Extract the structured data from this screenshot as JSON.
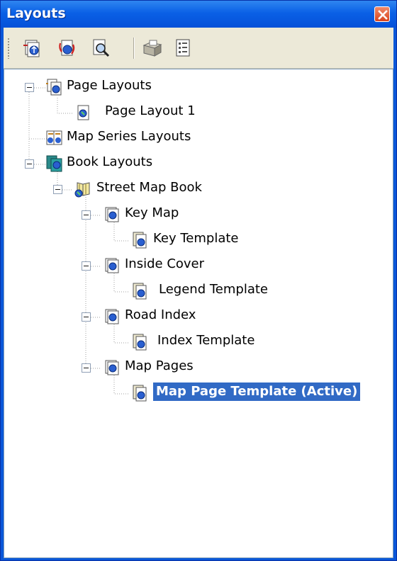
{
  "window": {
    "title": "Layouts",
    "close_icon": "close-icon"
  },
  "toolbar": {
    "buttons": [
      {
        "name": "new-layout-icon"
      },
      {
        "name": "refresh-layout-icon"
      },
      {
        "name": "zoom-layout-icon"
      },
      {
        "name": "open-layout-icon"
      },
      {
        "name": "properties-list-icon"
      }
    ]
  },
  "tree": {
    "nodes": [
      {
        "label": "Page Layouts",
        "icon": "page-layouts-folder-icon"
      },
      {
        "label": "Page Layout 1",
        "icon": "page-layout-icon"
      },
      {
        "label": "Map Series Layouts",
        "icon": "map-series-layouts-icon"
      },
      {
        "label": "Book Layouts",
        "icon": "book-layouts-icon"
      },
      {
        "label": "Street Map Book",
        "icon": "map-book-icon"
      },
      {
        "label": "Key Map",
        "icon": "section-page-icon"
      },
      {
        "label": "Key Template",
        "icon": "template-icon"
      },
      {
        "label": "Inside Cover",
        "icon": "section-page-icon"
      },
      {
        "label": "Legend Template",
        "icon": "template-icon"
      },
      {
        "label": "Road Index",
        "icon": "section-page-icon"
      },
      {
        "label": "Index Template",
        "icon": "template-icon"
      },
      {
        "label": "Map Pages",
        "icon": "section-page-icon"
      },
      {
        "label": "Map Page Template (Active)",
        "icon": "template-icon",
        "selected": true
      }
    ]
  },
  "colors": {
    "titlebar": "#0a60e6",
    "selection": "#316ac5",
    "toolbar": "#ece9d8"
  }
}
